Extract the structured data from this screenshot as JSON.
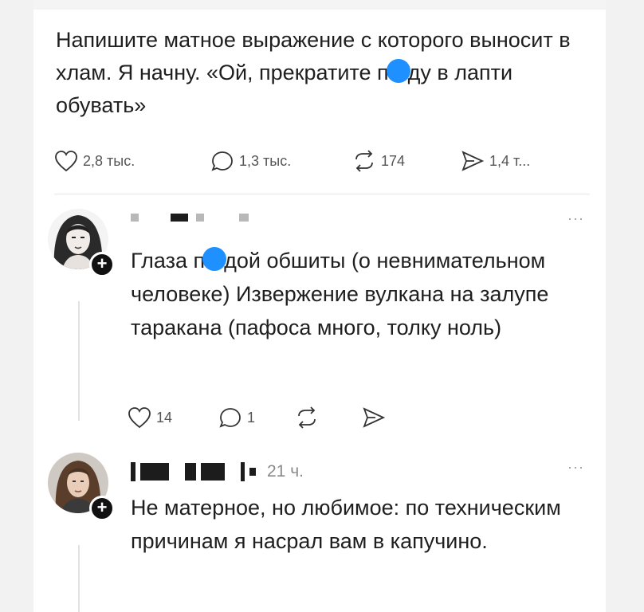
{
  "post": {
    "text_before": "Напишите матное выражение с которого выносит в хлам. Я начну. «Ой, прекратите п",
    "text_after": "ду в лапти обувать»",
    "likes": "2,8 тыс.",
    "comments": "1,3 тыс.",
    "reposts": "174",
    "shares": "1,4 т..."
  },
  "comments": [
    {
      "text_before": "Глаза п",
      "text_after": "дой обшиты (о невнимательном человеке) Извержение вулкана на залупе таракана (пафоса много, толку ноль)",
      "likes": "14",
      "replies": "1",
      "more": "···"
    },
    {
      "time": "21 ч.",
      "text": "Не матерное, но любимое: по техническим причинам я насрал вам в капучино.",
      "more": "···"
    }
  ],
  "colors": {
    "censor": "#1e90ff",
    "background": "#ffffff",
    "text": "#1f1f1f"
  },
  "icons": [
    "heart-icon",
    "comment-icon",
    "repost-icon",
    "share-icon",
    "plus-icon",
    "more-icon"
  ]
}
